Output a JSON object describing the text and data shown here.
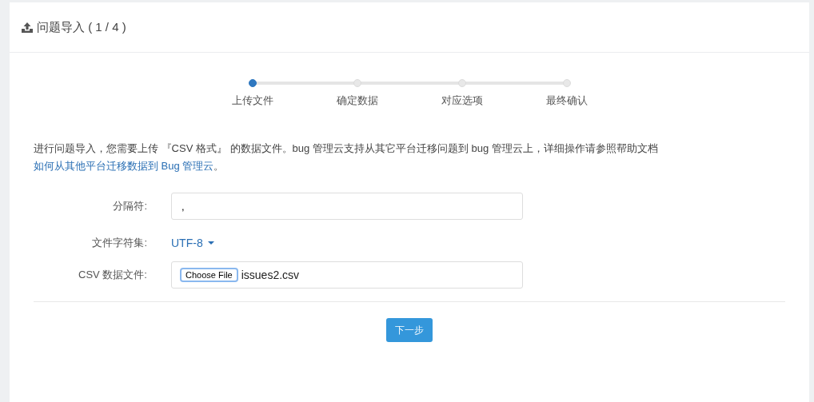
{
  "panel": {
    "title": "问题导入 ( 1 / 4 )"
  },
  "steps": [
    {
      "label": "上传文件",
      "selected": true
    },
    {
      "label": "确定数据",
      "selected": false
    },
    {
      "label": "对应选项",
      "selected": false
    },
    {
      "label": "最终确认",
      "selected": false
    }
  ],
  "intro": {
    "text": "进行问题导入，您需要上传 『CSV 格式』 的数据文件。bug 管理云支持从其它平台迁移问题到 bug 管理云上，详细操作请参照帮助文档 ",
    "link": "如何从其他平台迁移数据到 Bug 管理云",
    "end": "。"
  },
  "form": {
    "separator": {
      "label": "分隔符:",
      "value": ","
    },
    "charset": {
      "label": "文件字符集:",
      "value": "UTF-8"
    },
    "file": {
      "label": "CSV 数据文件:",
      "button": "Choose File",
      "filename": "issues2.csv"
    }
  },
  "next_button": "下一步"
}
